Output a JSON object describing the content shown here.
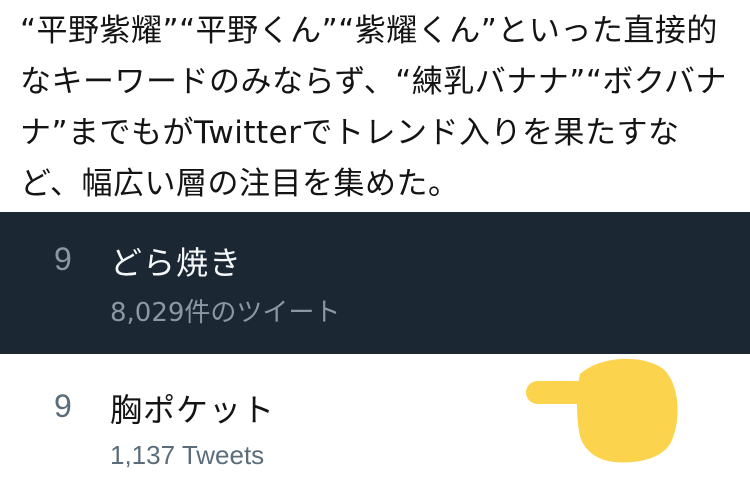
{
  "article": {
    "lines": [
      "“平野紫耀”“平野くん”“紫耀くん”といった直接的",
      "なキーワードのみならず、“練乳バナナ”“ボクバナ",
      "ナ”までもがTwitterでトレンド入りを果たすな",
      "ど、幅広い層の注目を集めた。"
    ]
  },
  "trends": [
    {
      "rank": "9",
      "topic": "どら焼き",
      "count": "8,029件のツイート",
      "theme": "dark",
      "background": "#1b2732"
    },
    {
      "rank": "9",
      "topic": "胸ポケット",
      "count": "1,137 Tweets",
      "theme": "light",
      "background": "#ffffff"
    }
  ],
  "decorations": {
    "pointer": {
      "icon": "backhand-index-pointing-right-icon",
      "color": "#fcd34d"
    }
  }
}
